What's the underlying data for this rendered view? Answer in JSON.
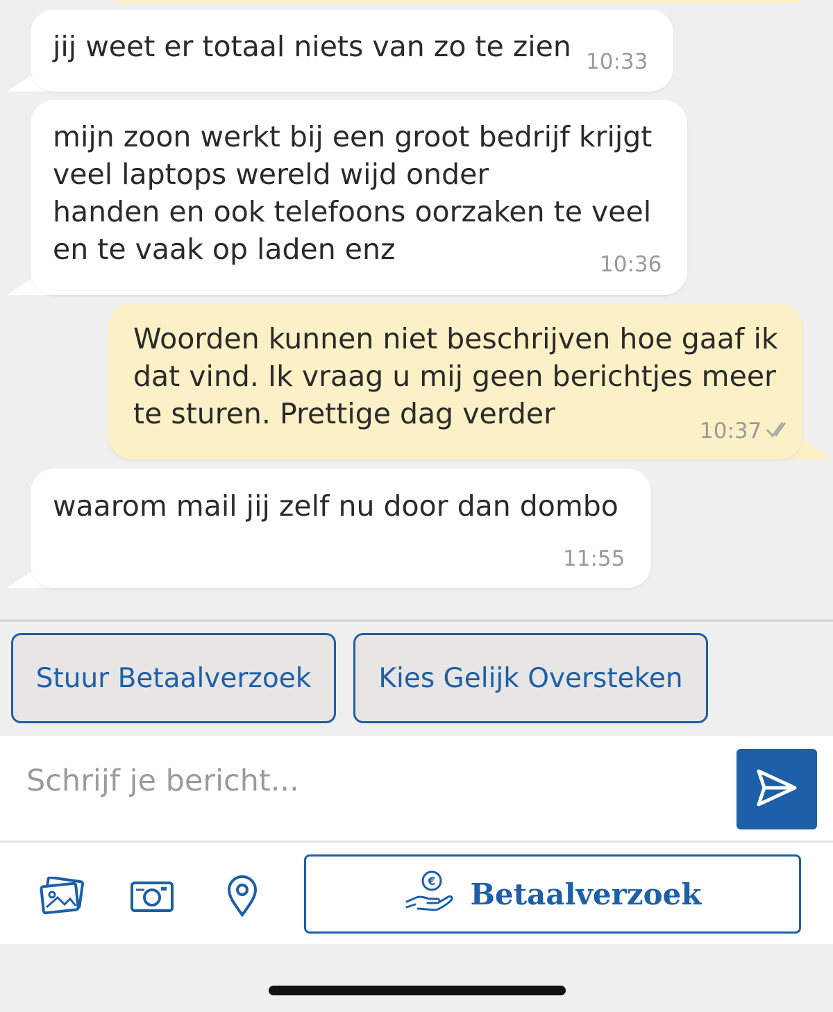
{
  "messages": [
    {
      "direction": "incoming",
      "text": "jij weet er totaal niets van zo te zien",
      "time": "10:33"
    },
    {
      "direction": "incoming",
      "text": "mijn zoon werkt bij een groot bedrijf krijgt\nveel laptops wereld wijd onder\nhanden en ook telefoons oorzaken te veel\nen te vaak op laden enz",
      "time": "10:36"
    },
    {
      "direction": "outgoing",
      "text": "Woorden kunnen niet beschrijven hoe gaaf ik\ndat vind. Ik vraag u mij geen berichtjes meer\nte sturen. Prettige dag verder",
      "time": "10:37",
      "status_icon": "double-check-icon"
    },
    {
      "direction": "incoming",
      "text": "waarom mail jij zelf nu door dan dombo",
      "time": "11:55"
    }
  ],
  "quick_replies": [
    {
      "label": "Stuur Betaalverzoek"
    },
    {
      "label": "Kies Gelijk Oversteken"
    }
  ],
  "composer": {
    "placeholder": "Schrijf je bericht...",
    "value": "",
    "send_icon": "send-icon"
  },
  "toolbar": {
    "icons": [
      "gallery-icon",
      "camera-icon",
      "location-pin-icon"
    ],
    "payment_button_label": "Betaalverzoek",
    "payment_icon": "euro-hand-icon"
  },
  "colors": {
    "accent": "#1d5fa8",
    "outgoing_bubble": "#fcf0c6",
    "incoming_bubble": "#ffffff",
    "background": "#efefef"
  }
}
